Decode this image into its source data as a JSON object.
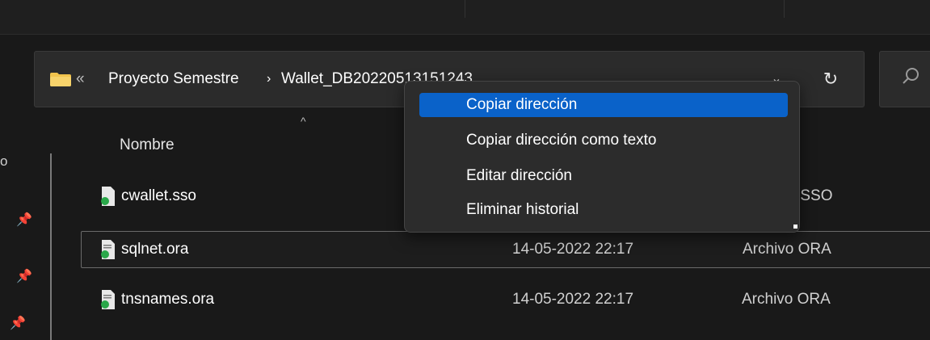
{
  "address_bar": {
    "overflow_chevron": "«",
    "crumbs": [
      "Proyecto Semestre",
      "Wallet_DB20220513151243"
    ],
    "separator": "›"
  },
  "columns": {
    "name": "Nombre"
  },
  "files": [
    {
      "name": "cwallet.sso",
      "date": "",
      "type": "vo SSO"
    },
    {
      "name": "sqlnet.ora",
      "date": "14-05-2022 22:17",
      "type": "Archivo ORA"
    },
    {
      "name": "tnsnames.ora",
      "date": "14-05-2022 22:17",
      "type": "Archivo ORA"
    }
  ],
  "context_menu": {
    "items": [
      "Copiar dirección",
      "Copiar dirección como texto",
      "Editar dirección",
      "Eliminar historial"
    ],
    "highlighted_index": 0
  },
  "nav_pane": {
    "partial_label": "o"
  },
  "icons": {
    "folder": "folder-icon",
    "refresh": "refresh-icon",
    "search": "search-icon",
    "dropdown": "chevron-down-icon",
    "pin": "pin-icon",
    "file": "file-icon"
  },
  "colors": {
    "background": "#191919",
    "menu_highlight": "#0a62c9",
    "folder": "#f2c44d",
    "file_badge": "#2aa84a"
  }
}
